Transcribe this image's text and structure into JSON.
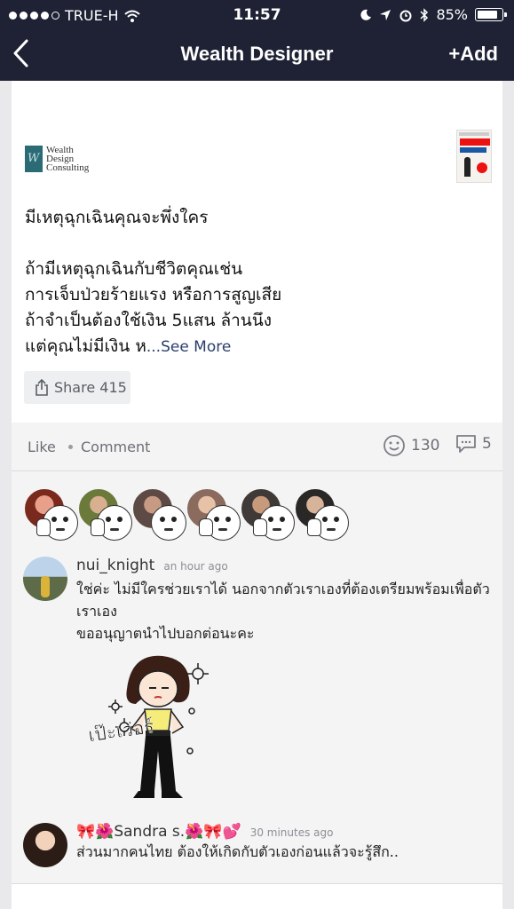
{
  "status_bar": {
    "carrier": "TRUE-H",
    "time": "11:57",
    "battery": "85%"
  },
  "nav": {
    "title": "Wealth Designer",
    "add_label": "+Add"
  },
  "post": {
    "logo_text": [
      "Wealth",
      "Design",
      "Consulting"
    ],
    "title": "มีเหตุฉุกเฉินคุณจะพึ่งใคร",
    "body_lines": [
      "ถ้ามีเหตุฉุกเฉินกับชีวิตคุณเช่น",
      "การเจ็บป่วยร้ายแรง หรือการสูญเสีย",
      "ถ้าจำเป็นต้องใช้เงิน 5แสน ล้านนึง",
      "แต่คุณไม่มีเงิน ห"
    ],
    "see_more": "...See More",
    "share_label": "Share 415"
  },
  "actions": {
    "like": "Like",
    "comment": "Comment",
    "reaction_count": "130",
    "comment_count": "5"
  },
  "comments": [
    {
      "name": "nui_knight",
      "time": "an hour ago",
      "lines": [
        "ใช่ค่ะ ไม่มีใครช่วยเราได้ นอกจากตัวเราเองที่ต้องเตรียมพร้อมเพื่อตัว",
        "เราเอง",
        "ขออนุญาตนำไปบอกต่อนะคะ"
      ],
      "sticker_text": "เป๊ะเว่อร์"
    },
    {
      "name": "🎀🌺Sandra s.🌺🎀💕",
      "time": "30 minutes ago",
      "lines": [
        "ส่วนมากคนไทย ต้องให้เกิดกับตัวเองก่อนแล้วจะรู้สึก.."
      ]
    }
  ],
  "colors": {
    "nav_bg": "#1e2234",
    "link": "#2a3f6b",
    "panel_bg": "#f4f4f5"
  }
}
